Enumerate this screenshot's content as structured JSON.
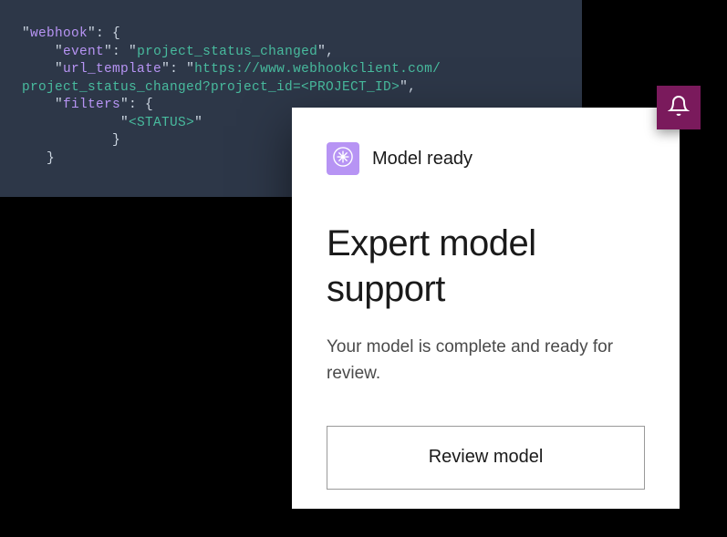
{
  "code": {
    "key_webhook": "webhook",
    "key_event": "event",
    "val_event": "project_status_changed",
    "key_url_template": "url_template",
    "val_url_template_1": "https://www.webhookclient.com/",
    "val_url_template_2": "project_status_changed?project_id=<PROJECT_ID>",
    "key_filters": "filters",
    "val_status": "<STATUS>"
  },
  "modal": {
    "header_label": "Model ready",
    "title": "Expert model support",
    "body": "Your model is complete and ready for review.",
    "button_label": "Review model"
  },
  "colors": {
    "badge_bg": "#7a1a5c",
    "icon_bg": "#b794f4",
    "code_bg": "#2d3748"
  }
}
